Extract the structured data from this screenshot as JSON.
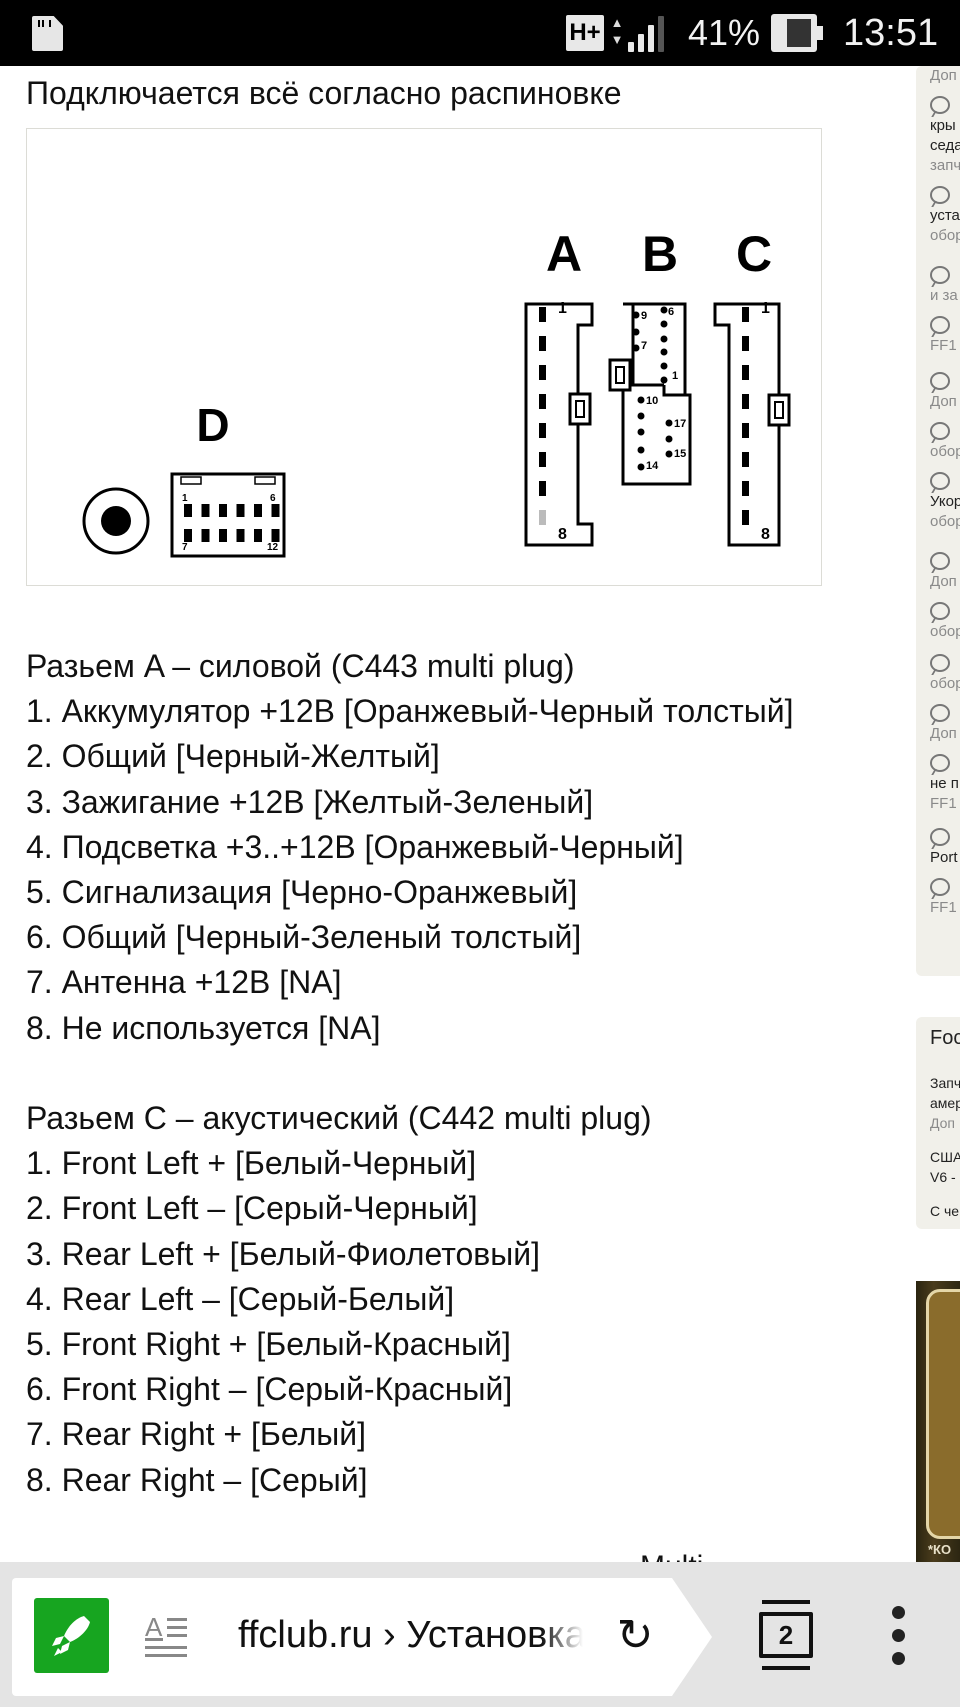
{
  "status_bar": {
    "network_type": "H+",
    "battery_percent": "41%",
    "battery_level": 0.41,
    "time": "13:51",
    "icons": [
      "sd-card-icon",
      "network-type-icon",
      "data-arrows-icon",
      "signal-icon",
      "battery-icon"
    ]
  },
  "article": {
    "intro": "Подключается всё согласно распиновке",
    "diagram": {
      "description": "Connector pinout diagram",
      "connectors": [
        {
          "label": "A",
          "pins_first": "1",
          "pins_last": "8"
        },
        {
          "label": "B",
          "pin_labels": [
            "9",
            "7",
            "6",
            "1",
            "10",
            "17",
            "15",
            "14"
          ]
        },
        {
          "label": "C",
          "pins_first": "1",
          "pins_last": "8"
        },
        {
          "label": "D",
          "pin_labels": [
            "1",
            "6",
            "7",
            "12"
          ]
        }
      ]
    },
    "connector_a": {
      "heading": "Разьем A – силовой (C443 multi plug)",
      "pins": [
        "1. Аккумулятор +12В [Оранжевый-Черный толстый]",
        "2. Общий [Черный-Желтый]",
        "3. Зажигание +12В [Желтый-Зеленый]",
        "4. Подсветка +3..+12В [Оранжевый-Черный]",
        "5. Сигнализация [Черно-Оранжевый]",
        "6. Общий [Черный-Зеленый толстый]",
        "7. Антенна +12В [NA]",
        "8. Не используется [NA]"
      ]
    },
    "connector_c": {
      "heading": "Разьем C – акустический (C442 multi plug)",
      "pins": [
        "1. Front Left + [Белый-Черный]",
        "2. Front Left – [Серый-Черный]",
        "3. Rear Left + [Белый-Фиолетовый]",
        "4. Rear Left – [Серый-Белый]",
        "5. Front Right + [Белый-Красный]",
        "6. Front Right – [Серый-Красный]",
        "7. Rear Right + [Белый]",
        "8. Rear Right – [Серый]"
      ]
    },
    "cutoff_text": "Multi"
  },
  "sidebar": {
    "items": [
      {
        "lines": [
          "Доп"
        ],
        "style": [
          "grey"
        ]
      },
      {
        "lines": [
          "кры",
          "седа",
          "запч"
        ],
        "style": [
          "dark",
          "dark",
          "grey"
        ]
      },
      {
        "lines": [
          "уста",
          "обор"
        ],
        "style": [
          "dark",
          "grey"
        ]
      },
      {
        "lines": [
          "и за"
        ],
        "style": [
          "grey"
        ]
      },
      {
        "lines": [
          "FF1"
        ],
        "style": [
          "grey"
        ]
      },
      {
        "lines": [
          "Доп"
        ],
        "style": [
          "grey"
        ]
      },
      {
        "lines": [
          "обор"
        ],
        "style": [
          "grey"
        ]
      },
      {
        "lines": [
          "Укор",
          "обор"
        ],
        "style": [
          "dark",
          "grey"
        ]
      },
      {
        "lines": [
          "Доп"
        ],
        "style": [
          "grey"
        ]
      },
      {
        "lines": [
          "обор"
        ],
        "style": [
          "grey"
        ]
      },
      {
        "lines": [
          "обор"
        ],
        "style": [
          "grey"
        ]
      },
      {
        "lines": [
          "Доп"
        ],
        "style": [
          "grey"
        ]
      },
      {
        "lines": [
          "не п",
          "FF1"
        ],
        "style": [
          "dark",
          "grey"
        ]
      },
      {
        "lines": [
          "Port"
        ],
        "style": [
          "dark"
        ]
      },
      {
        "lines": [
          "FF1"
        ],
        "style": [
          "grey"
        ]
      }
    ],
    "card": {
      "title": "Foc",
      "lines": [
        "Запч",
        "амер",
        "Доп",
        "США",
        "V6 -",
        "С че"
      ]
    },
    "ad_text": "*КО"
  },
  "browser_bar": {
    "url_display": "ffclub.ru › Установка",
    "tab_count": "2",
    "colors": {
      "turbo_green": "#17a520"
    }
  }
}
